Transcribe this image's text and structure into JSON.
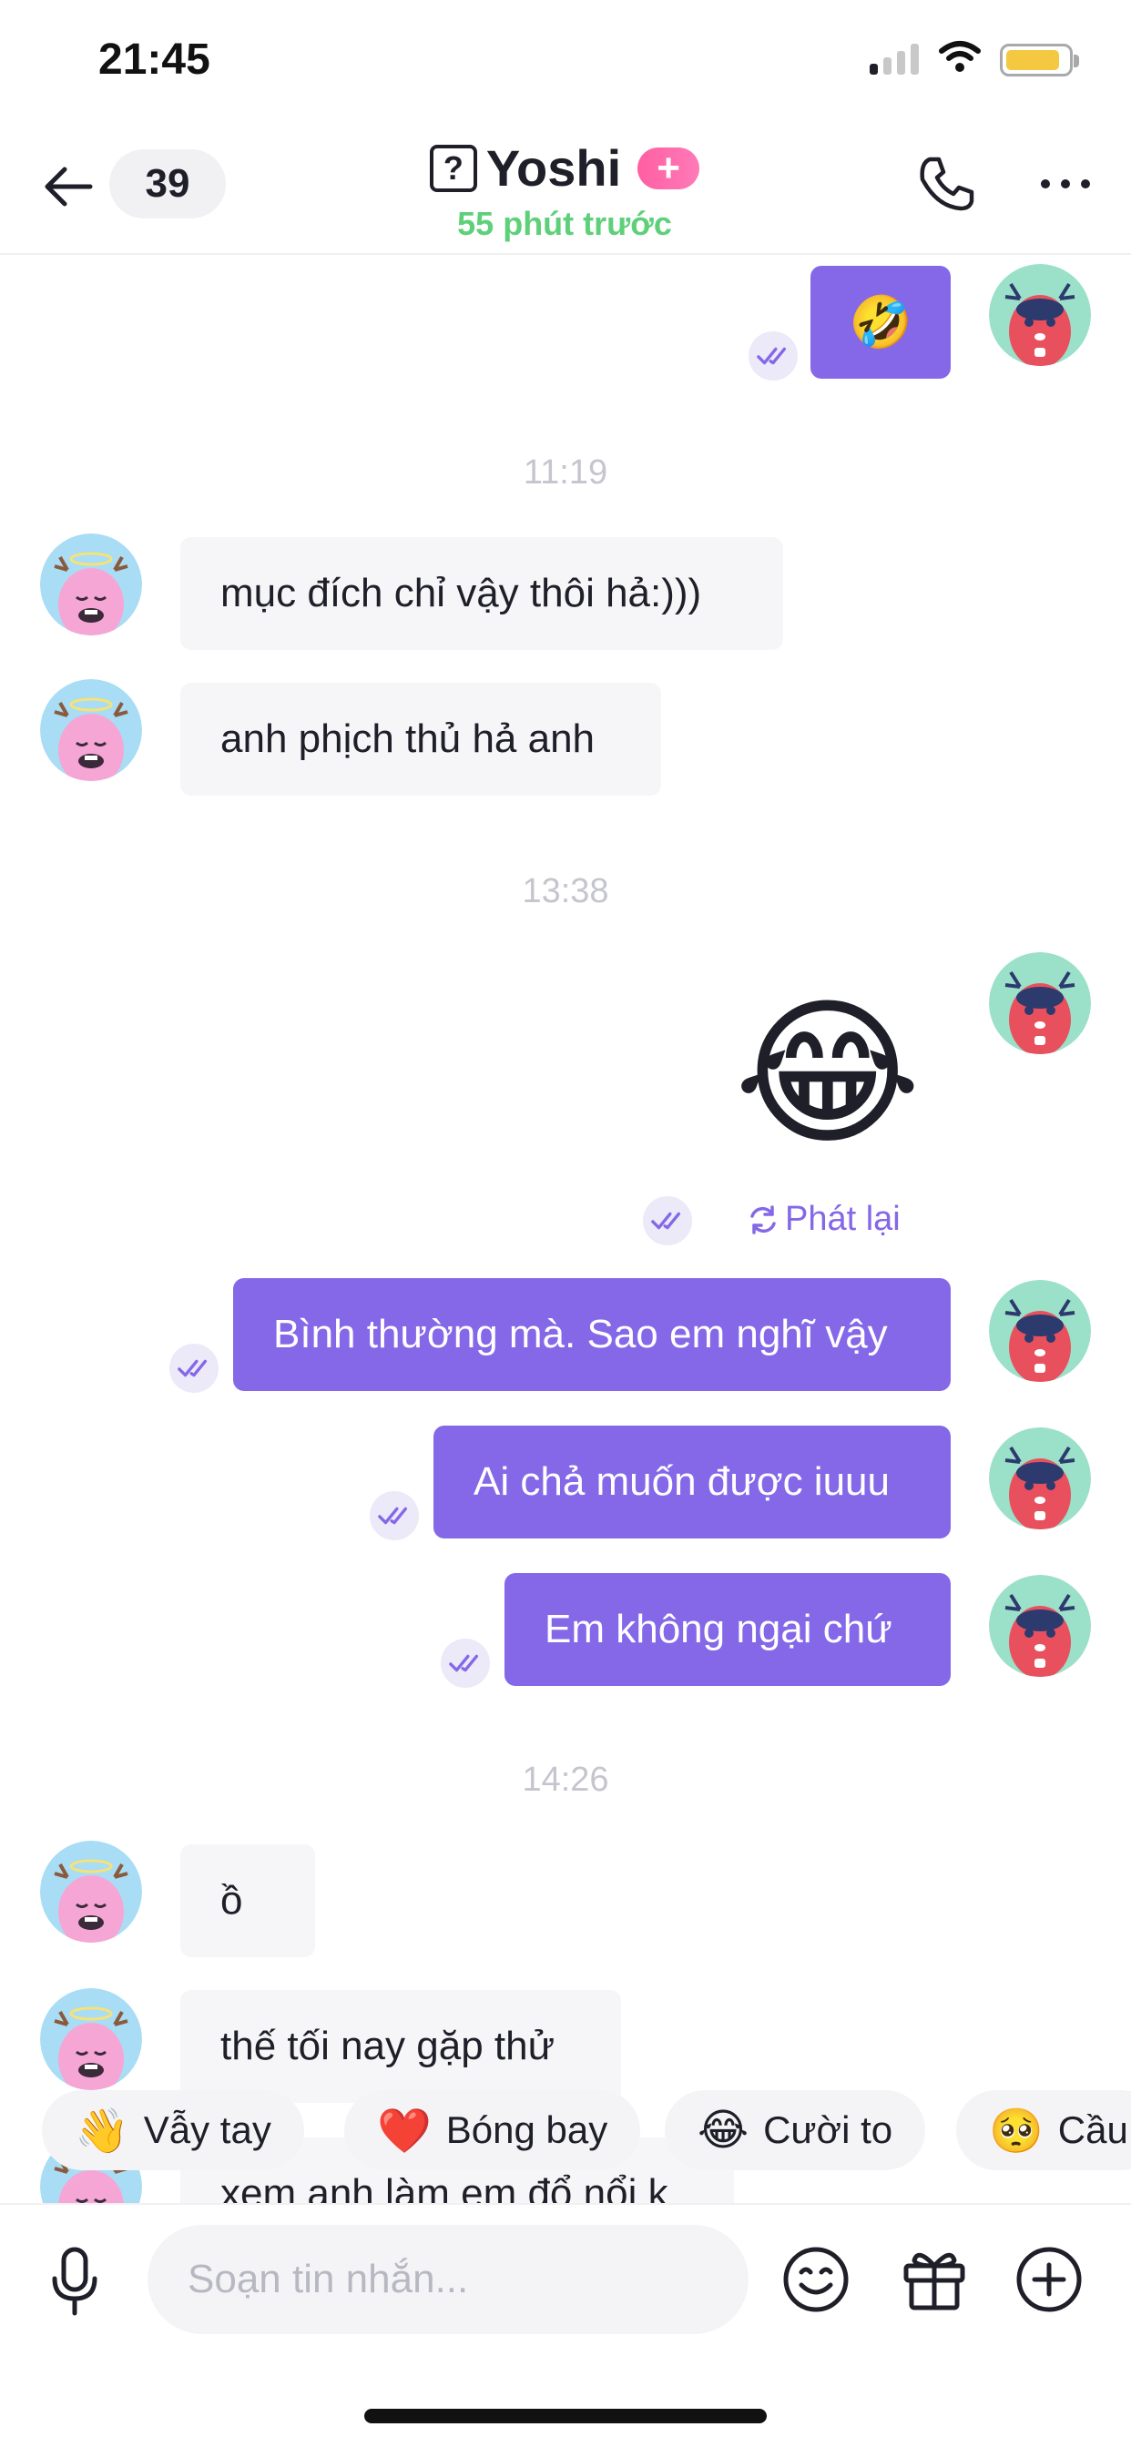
{
  "status_bar": {
    "time": "21:45"
  },
  "header": {
    "unread_count": "39",
    "contact_name": "Yoshi",
    "plus_badge": "+",
    "help_glyph": "?",
    "last_seen": "55 phút trước"
  },
  "conversation": {
    "top_emoji": "🤣",
    "time_1": "11:19",
    "msg_1": "mục đích chỉ vậy thôi hả:)))",
    "msg_2": "anh phịch thủ hả anh",
    "time_2": "13:38",
    "big_emoji": "😂",
    "replay_label": "Phát lại",
    "msg_3": "Bình thường mà. Sao em nghĩ vậy",
    "msg_4": "Ai chả muốn được iuuu",
    "msg_5": "Em không ngại chứ",
    "time_3": "14:26",
    "msg_6": "ồ",
    "msg_7": "thế tối nay gặp thử",
    "msg_8": "xem anh làm em đổ nổi k"
  },
  "quick_reactions": [
    {
      "emoji": "👋",
      "label": "Vẫy tay"
    },
    {
      "emoji": "❤️",
      "label": "Bóng bay"
    },
    {
      "emoji": "😂",
      "label": "Cười to"
    },
    {
      "emoji": "🥺",
      "label": "Cầu"
    }
  ],
  "composer": {
    "placeholder": "Soạn tin nhắn..."
  },
  "colors": {
    "accent": "#8468e8",
    "online": "#5fd07a",
    "badge": "#ff6aa9"
  }
}
